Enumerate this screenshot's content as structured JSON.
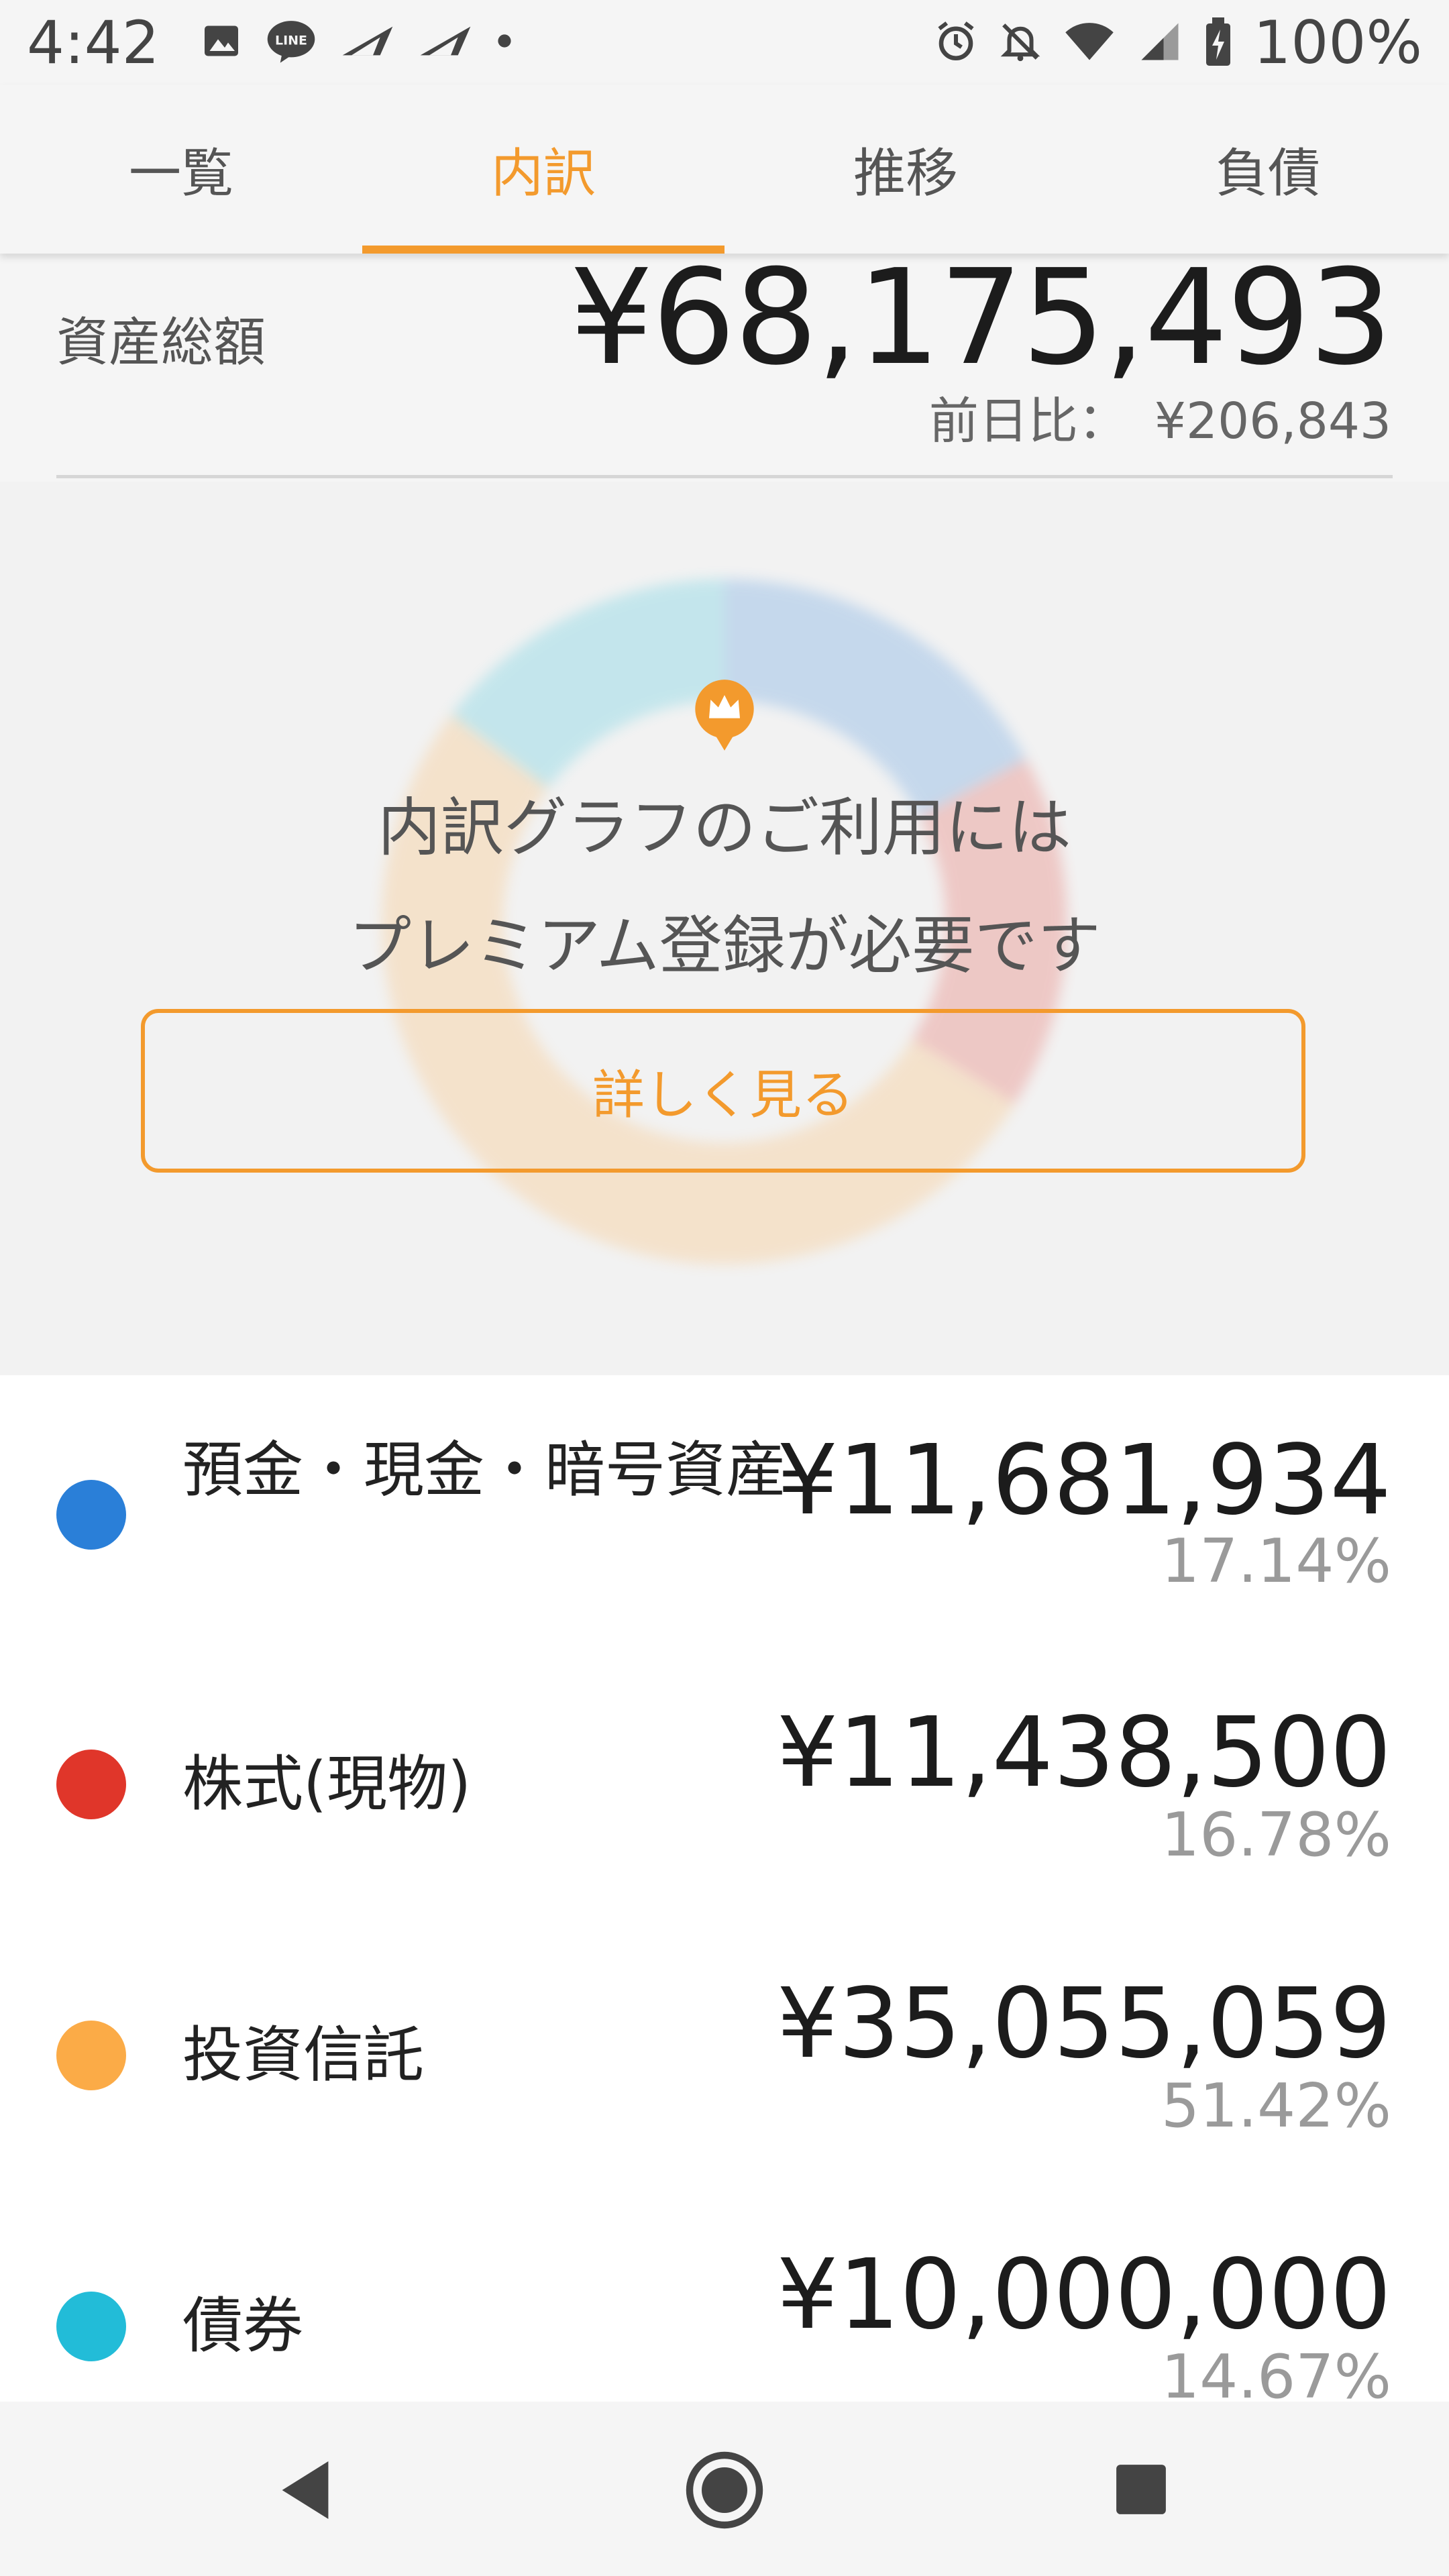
{
  "status_bar": {
    "time": "4:42",
    "battery_percent": "100%",
    "left_icons": [
      "image-icon",
      "line-icon",
      "paper-plane-icon",
      "paper-plane-icon",
      "dot-icon"
    ],
    "right_icons": [
      "alarm-icon",
      "bell-off-icon",
      "wifi-icon",
      "signal-icon",
      "battery-charging-icon"
    ]
  },
  "tabs": [
    {
      "label": "一覧",
      "active": false
    },
    {
      "label": "内訳",
      "active": true
    },
    {
      "label": "推移",
      "active": false
    },
    {
      "label": "負債",
      "active": false
    }
  ],
  "summary": {
    "total_label": "資産総額",
    "total_amount": "¥68,175,493",
    "diff_label": "前日比：",
    "diff_amount": "¥206,843"
  },
  "premium": {
    "line1": "内訳グラフのご利用には",
    "line2": "プレミアム登録が必要です",
    "button_label": "詳しく見る"
  },
  "assets": [
    {
      "label": "預金・現金・暗号資産",
      "amount": "¥11,681,934",
      "percent": "17.14%",
      "color": "#2a7fd8",
      "share": 17.14
    },
    {
      "label": "株式(現物)",
      "amount": "¥11,438,500",
      "percent": "16.78%",
      "color": "#e0362a",
      "share": 16.78
    },
    {
      "label": "投資信託",
      "amount": "¥35,055,059",
      "percent": "51.42%",
      "color": "#fbab47",
      "share": 51.42
    },
    {
      "label": "債券",
      "amount": "¥10,000,000",
      "percent": "14.67%",
      "color": "#22bcd8",
      "share": 14.67
    }
  ],
  "colors": {
    "accent": "#f39a2d"
  }
}
